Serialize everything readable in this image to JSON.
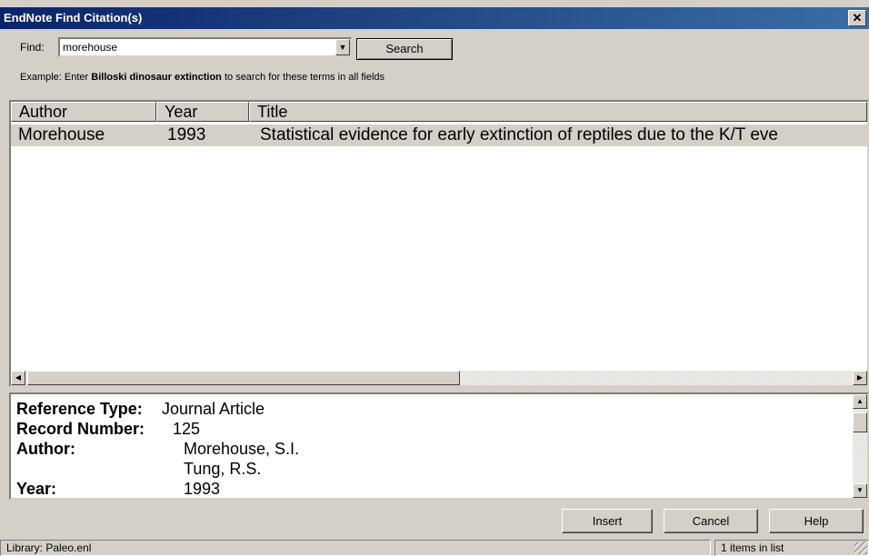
{
  "window": {
    "title": "EndNote Find Citation(s)",
    "close_glyph": "✕"
  },
  "find": {
    "label": "Find:",
    "value": "morehouse",
    "search_button": "Search",
    "example_prefix": "Example: Enter ",
    "example_bold": "Billoski dinosaur extinction",
    "example_suffix": " to search for these terms in all fields"
  },
  "list": {
    "columns": [
      "Author",
      "Year",
      "Title"
    ],
    "rows": [
      {
        "author": "Morehouse",
        "year": "1993",
        "title": "Statistical evidence for early extinction of reptiles due to the K/T eve"
      }
    ]
  },
  "preview": {
    "fields": [
      {
        "label": "Reference Type:",
        "value": "Journal Article"
      },
      {
        "label": "Record Number:",
        "value": "125"
      },
      {
        "label": "Author:",
        "value": "Morehouse, S.I."
      },
      {
        "label": "",
        "value": "Tung, R.S."
      },
      {
        "label": "Year:",
        "value": "1993"
      }
    ]
  },
  "buttons": {
    "insert": "Insert",
    "cancel": "Cancel",
    "help": "Help"
  },
  "status": {
    "library": "Library: Paleo.enl",
    "count": "1 items in list"
  },
  "icons": {
    "dropdown": "chevron-down-icon",
    "scroll_left": "arrow-left-icon",
    "scroll_right": "arrow-right-icon",
    "scroll_up": "arrow-up-icon",
    "scroll_down": "arrow-down-icon"
  }
}
